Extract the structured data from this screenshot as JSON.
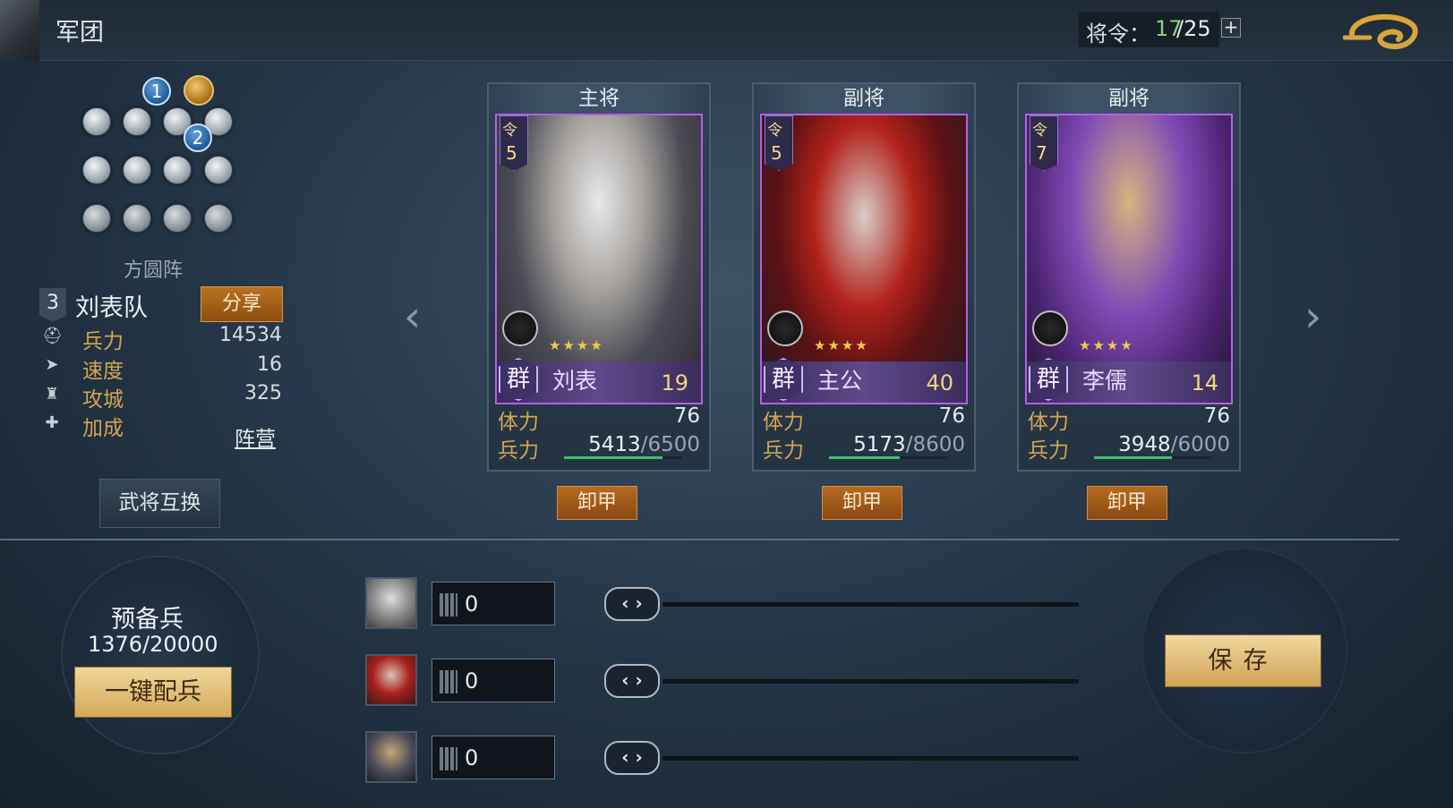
{
  "header": {
    "title": "军团",
    "orders_label": "将令：",
    "orders_current": "17",
    "orders_max": "/25",
    "orders_plus": "+"
  },
  "formation": {
    "name": "方圆阵",
    "position_badges": [
      "1",
      "2"
    ]
  },
  "team": {
    "number": "3",
    "name": "刘表队",
    "share_label": "分享",
    "stats": [
      {
        "label": "兵力",
        "value": "14534",
        "icon": "helmet-icon"
      },
      {
        "label": "速度",
        "value": "16",
        "icon": "speed-icon"
      },
      {
        "label": "攻城",
        "value": "325",
        "icon": "siege-icon"
      },
      {
        "label": "加成",
        "value": "阵营",
        "icon": "plus-icon"
      }
    ],
    "swap_label": "武将互换"
  },
  "nav": {
    "prev": "‹",
    "next": "›"
  },
  "cards": [
    {
      "role": "主将",
      "cost_char": "令",
      "cost": "5",
      "faction": "群",
      "name": "刘表",
      "level": "19",
      "stamina_label": "体力",
      "stamina": "76",
      "troops_label": "兵力",
      "troops_cur": "5413",
      "troops_max": "/6500",
      "troops_fill": 0.83,
      "stars": "★★★★",
      "unequip": "卸甲"
    },
    {
      "role": "副将",
      "cost_char": "令",
      "cost": "5",
      "faction": "群",
      "name": "主公",
      "level": "40",
      "stamina_label": "体力",
      "stamina": "76",
      "troops_label": "兵力",
      "troops_cur": "5173",
      "troops_max": "/8600",
      "troops_fill": 0.6,
      "stars": "★★★★",
      "unequip": "卸甲"
    },
    {
      "role": "副将",
      "cost_char": "令",
      "cost": "7",
      "faction": "群",
      "name": "李儒",
      "level": "14",
      "stamina_label": "体力",
      "stamina": "76",
      "troops_label": "兵力",
      "troops_cur": "3948",
      "troops_max": "/6000",
      "troops_fill": 0.66,
      "stars": "★★★★",
      "unequip": "卸甲"
    }
  ],
  "reserve": {
    "title": "预备兵",
    "count": "1376/20000",
    "auto_label": "一键配兵"
  },
  "allocation": [
    {
      "value": "0",
      "stepper": "‹ ›"
    },
    {
      "value": "0",
      "stepper": "‹ ›"
    },
    {
      "value": "0",
      "stepper": "‹ ›"
    }
  ],
  "save_label": "保存"
}
